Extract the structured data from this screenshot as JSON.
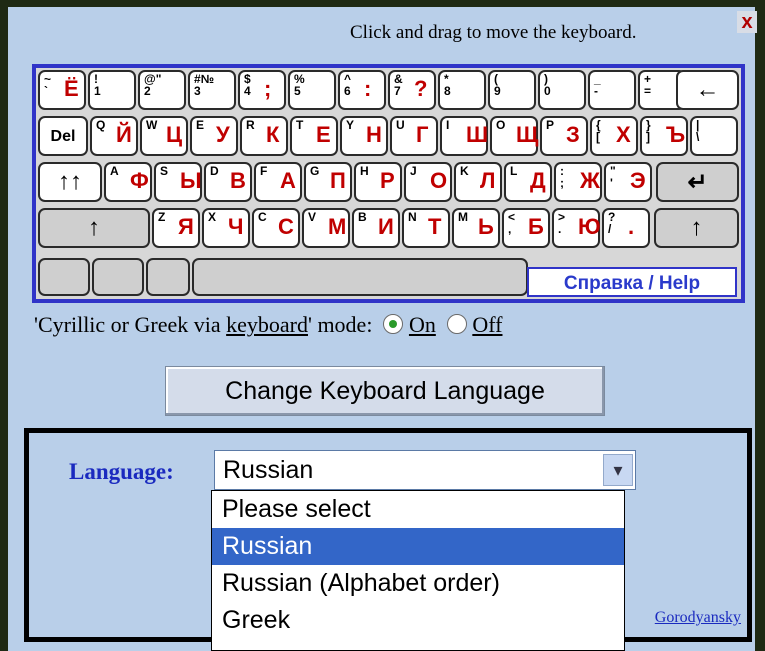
{
  "header": {
    "drag_hint": "Click and drag to move the keyboard.",
    "close_label": "x"
  },
  "keyboard": {
    "row1": [
      {
        "small": "~\n`",
        "big": "Ё"
      },
      {
        "small": "!\n1",
        "big": ""
      },
      {
        "small": "@\"\n2",
        "big": ""
      },
      {
        "small": "#№\n3",
        "big": ""
      },
      {
        "small": "$\n4",
        "big": ";"
      },
      {
        "small": "%\n5",
        "big": ""
      },
      {
        "small": "^\n6",
        "big": ":"
      },
      {
        "small": "&\n7",
        "big": "?"
      },
      {
        "small": "*\n8",
        "big": ""
      },
      {
        "small": "(\n9",
        "big": ""
      },
      {
        "small": ")\n0",
        "big": ""
      },
      {
        "small": "_\n-",
        "big": ""
      },
      {
        "small": "+\n=",
        "big": ""
      }
    ],
    "backspace_label": "←",
    "row2_lead": "Del",
    "row2": [
      {
        "small": "Q",
        "big": "Й"
      },
      {
        "small": "W",
        "big": "Ц"
      },
      {
        "small": "E",
        "big": "У"
      },
      {
        "small": "R",
        "big": "К"
      },
      {
        "small": "T",
        "big": "Е"
      },
      {
        "small": "Y",
        "big": "Н"
      },
      {
        "small": "U",
        "big": "Г"
      },
      {
        "small": "I",
        "big": "Ш"
      },
      {
        "small": "O",
        "big": "Щ"
      },
      {
        "small": "P",
        "big": "З"
      },
      {
        "small": "{\n[",
        "big": "Х"
      },
      {
        "small": "}\n]",
        "big": "Ъ"
      },
      {
        "small": "|\n\\",
        "big": ""
      }
    ],
    "row3_lead": "↑↑",
    "row3": [
      {
        "small": "A",
        "big": "Ф"
      },
      {
        "small": "S",
        "big": "Ы"
      },
      {
        "small": "D",
        "big": "В"
      },
      {
        "small": "F",
        "big": "А"
      },
      {
        "small": "G",
        "big": "П"
      },
      {
        "small": "H",
        "big": "Р"
      },
      {
        "small": "J",
        "big": "О"
      },
      {
        "small": "K",
        "big": "Л"
      },
      {
        "small": "L",
        "big": "Д"
      },
      {
        "small": ":\n;",
        "big": "Ж"
      },
      {
        "small": "\"\n'",
        "big": "Э"
      }
    ],
    "enter_label": "↵",
    "row4_lead": "↑",
    "row4": [
      {
        "small": "Z",
        "big": "Я"
      },
      {
        "small": "X",
        "big": "Ч"
      },
      {
        "small": "C",
        "big": "С"
      },
      {
        "small": "V",
        "big": "М"
      },
      {
        "small": "B",
        "big": "И"
      },
      {
        "small": "N",
        "big": "Т"
      },
      {
        "small": "M",
        "big": "Ь"
      },
      {
        "small": "<\n,",
        "big": "Б"
      },
      {
        "small": ">\n.",
        "big": "Ю"
      },
      {
        "small": "?\n/",
        "big": "."
      }
    ],
    "row4_trail": "↑",
    "help_link": "Справка / Help"
  },
  "mode": {
    "label_pre": "'Cyrillic or Greek via ",
    "label_link": "keyboard",
    "label_post": "' mode:",
    "on_label": "On",
    "off_label": "Off",
    "selected": "On"
  },
  "change_language_button": "Change Keyboard Language",
  "language_panel": {
    "label": "Language:",
    "selected_value": "Russian",
    "credit_text": "Gorodyansky",
    "options": [
      "Please select",
      "Russian",
      "Russian (Alphabet order)",
      "Greek"
    ]
  }
}
